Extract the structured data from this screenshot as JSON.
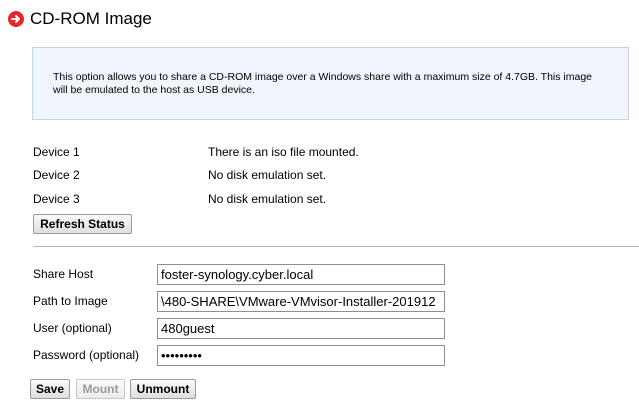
{
  "header": {
    "title": "CD-ROM Image",
    "icon": "arrow-right-circle-icon",
    "icon_color": "#e8262b"
  },
  "info": {
    "text": "This option allows you to share a CD-ROM image over a Windows share with a maximum size of 4.7GB. This image will be emulated to the host as USB device."
  },
  "devices": [
    {
      "label": "Device 1",
      "status": "There is an iso file mounted."
    },
    {
      "label": "Device 2",
      "status": "No disk emulation set."
    },
    {
      "label": "Device 3",
      "status": "No disk emulation set."
    }
  ],
  "refresh_label": "Refresh Status",
  "form": {
    "share_host": {
      "label": "Share Host",
      "value": "foster-synology.cyber.local"
    },
    "path": {
      "label": "Path to Image",
      "value": "\\480-SHARE\\VMware-VMvisor-Installer-201912"
    },
    "user": {
      "label": "User (optional)",
      "value": "480guest"
    },
    "password": {
      "label": "Password (optional)",
      "value": "•••••••••"
    }
  },
  "buttons": {
    "save": "Save",
    "mount": "Mount",
    "unmount": "Unmount"
  }
}
